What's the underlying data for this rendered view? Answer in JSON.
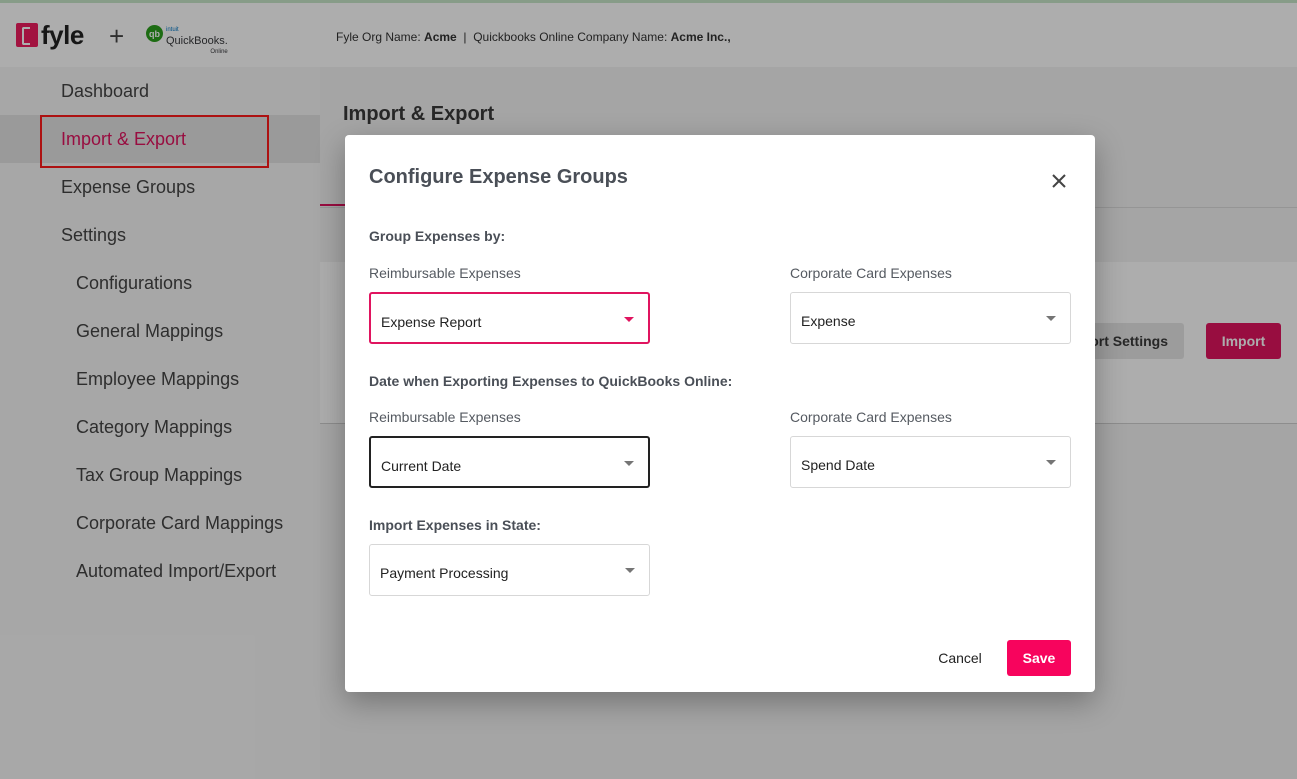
{
  "header": {
    "fyle_logo_text": "fyle",
    "plus": "+",
    "qb_logo": {
      "circle": "qb",
      "brand_small": "intuit",
      "name": "QuickBooks.",
      "sub": "Online"
    },
    "org_label": "Fyle Org Name:",
    "org_name": "Acme",
    "separator": "|",
    "qbo_label": "Quickbooks Online Company Name:",
    "qbo_name": "Acme Inc.,"
  },
  "sidebar": {
    "items": [
      {
        "label": "Dashboard"
      },
      {
        "label": "Import & Export",
        "active": true
      },
      {
        "label": "Expense Groups"
      },
      {
        "label": "Settings"
      },
      {
        "label": "Configurations"
      },
      {
        "label": "General Mappings"
      },
      {
        "label": "Employee Mappings"
      },
      {
        "label": "Category Mappings"
      },
      {
        "label": "Tax Group Mappings"
      },
      {
        "label": "Corporate Card Mappings"
      },
      {
        "label": "Automated Import/Export"
      }
    ]
  },
  "main": {
    "title": "Import & Export",
    "settings_button": "ort Settings",
    "import_button": "Import"
  },
  "dialog": {
    "title": "Configure Expense Groups",
    "group_section": "Group Expenses by:",
    "date_section": "Date when Exporting Expenses to QuickBooks Online:",
    "state_section": "Import Expenses in State:",
    "reimbursable_label": "Reimbursable Expenses",
    "ccc_label": "Corporate Card Expenses",
    "group_reimbursable_value": "Expense Report",
    "group_ccc_value": "Expense",
    "date_reimbursable_value": "Current Date",
    "date_ccc_value": "Spend Date",
    "state_value": "Payment Processing",
    "cancel": "Cancel",
    "save": "Save"
  },
  "colors": {
    "accent": "#e0145f",
    "save": "#f7045d",
    "qb_green": "#2ca01c"
  }
}
